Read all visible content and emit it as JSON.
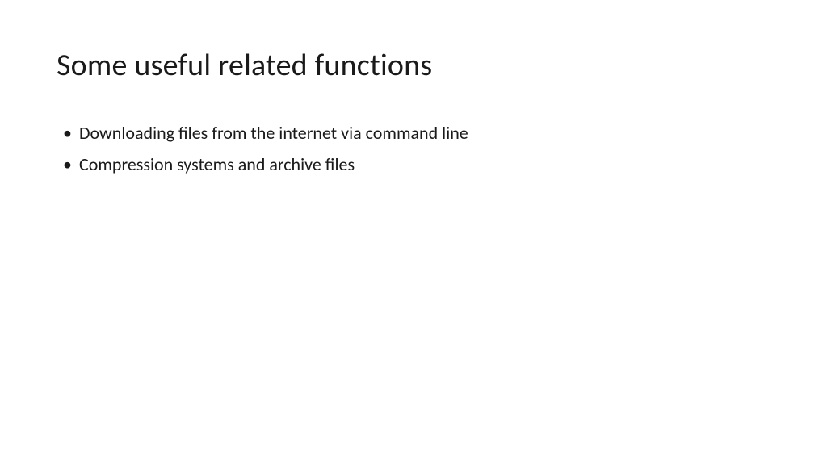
{
  "slide": {
    "title": "Some useful related functions",
    "bullets": [
      "Downloading files from the internet via command line",
      "Compression systems and archive files"
    ]
  }
}
